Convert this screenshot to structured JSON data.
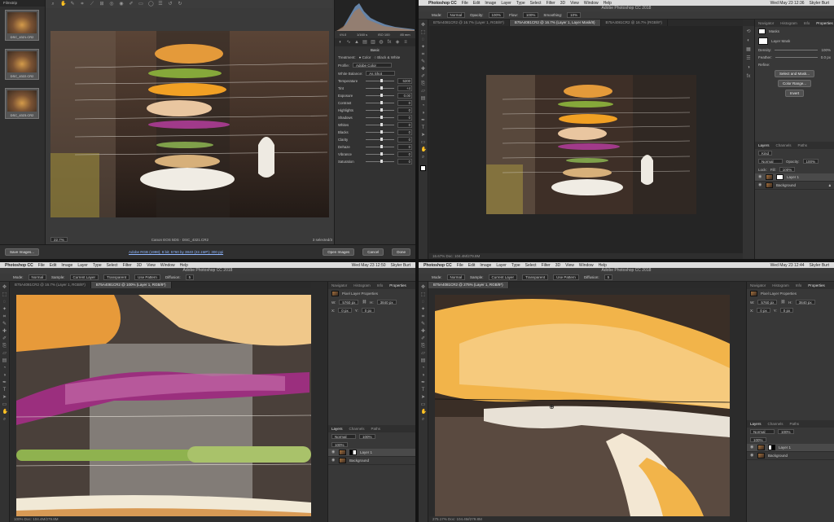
{
  "q1": {
    "filmstrip_title": "Filmstrip",
    "filmstrip": [
      "DSC_4321.CR2",
      "DSC_4322.CR2",
      "DSC_4323.CR2"
    ],
    "zoom": "22.7%",
    "center_caption": "Canon EOS 5DS  ·  DSC_4321.CR2",
    "selected_count": "3 selected/3",
    "bottom_link": "Adobe RGB (1998); 8 bit; 5760 by 3840 (22.1MP); 300 ppi",
    "save_button": "Save Images...",
    "open_button": "Open Images",
    "cancel_button": "Cancel",
    "done_button": "Done",
    "histo_readout": [
      "f/4.0",
      "1/160 s",
      "ISO 100",
      "85 mm"
    ],
    "basic_label": "Basic",
    "treatment_label": "Treatment:",
    "treatment_color": "Color",
    "treatment_bw": "Black & White",
    "profile_label": "Profile:",
    "profile_value": "Adobe Color",
    "wb_label": "White Balance:",
    "wb_value": "As Shot",
    "auto_label": "Auto",
    "default_label": "Default",
    "sliders": [
      {
        "label": "Temperature",
        "value": "5200"
      },
      {
        "label": "Tint",
        "value": "+4"
      },
      {
        "label": "Exposure",
        "value": "0.00"
      },
      {
        "label": "Contrast",
        "value": "0"
      },
      {
        "label": "Highlights",
        "value": "0"
      },
      {
        "label": "Shadows",
        "value": "0"
      },
      {
        "label": "Whites",
        "value": "0"
      },
      {
        "label": "Blacks",
        "value": "0"
      },
      {
        "label": "Clarity",
        "value": "0"
      },
      {
        "label": "Dehaze",
        "value": "0"
      },
      {
        "label": "Vibrance",
        "value": "0"
      },
      {
        "label": "Saturation",
        "value": "0"
      }
    ]
  },
  "menu": {
    "app": "Photoshop CC",
    "items": [
      "File",
      "Edit",
      "Image",
      "Layer",
      "Type",
      "Select",
      "Filter",
      "3D",
      "View",
      "Window",
      "Help"
    ],
    "clock_a": "Wed May 23 12:36",
    "clock_b": "Wed May 23 12:50",
    "clock_c": "Wed May 23 12:44",
    "user": "Skyler Burt"
  },
  "window_title": "Adobe Photoshop CC 2018",
  "q2": {
    "opt": [
      "Mode:",
      "Normal",
      "Opacity:",
      "100%",
      "Flow:",
      "100%",
      "Smoothing:",
      "10%"
    ],
    "tabs": [
      "B75A4081CR2 @ 16.7% (Layer 1, RGB/8*)",
      "B75A4081CR2 @ 16.7% (Layer 1, Layer Mask/8)",
      "B75A4081CR2 @ 16.7% (RGB/8*)"
    ],
    "status": "16.67%    Doc: 104.4M/279.8M",
    "panel_tabs": [
      "Navigator",
      "Histogram",
      "Info",
      "Properties"
    ],
    "props_title": "Masks",
    "mask_label": "Layer Mask",
    "density": "Density:",
    "density_val": "100%",
    "feather": "Feather:",
    "feather_val": "0.0 px",
    "refine": "Refine:",
    "select_mask": "Select and Mask...",
    "color_range": "Color Range...",
    "invert": "Invert",
    "layers_tabs": [
      "Layers",
      "Channels",
      "Paths"
    ],
    "kind": "Kind",
    "blend": "Normal",
    "opacity_label": "Opacity:",
    "opacity": "100%",
    "lock_label": "Lock:",
    "fill_label": "Fill:",
    "fill": "100%",
    "layers": [
      "Layer 1",
      "Background"
    ]
  },
  "q3": {
    "opt": [
      "Mode:",
      "Normal",
      "Sample:",
      "Current Layer",
      "Transparent",
      "Use Pattern",
      "Diffusion:",
      "5"
    ],
    "tabs": [
      "B75A4081CR2 @ 16.7% (Layer 1, RGB/8*)",
      "B75A4081CR2 @ 100% (Layer 1, RGB/8*)"
    ],
    "status": "100%    Doc: 104.4M/279.8M",
    "panel_tabs": [
      "Navigator",
      "Histogram",
      "Info",
      "Properties"
    ],
    "props_title": "Pixel Layer Properties",
    "w_label": "W:",
    "w_val": "5760 px",
    "h_label": "H:",
    "h_val": "3840 px",
    "x_label": "X:",
    "x_val": "0 px",
    "y_label": "Y:",
    "y_val": "0 px",
    "layers_tabs": [
      "Layers",
      "Channels",
      "Paths"
    ],
    "blend": "Normal",
    "opacity": "100%",
    "fill": "100%",
    "layers": [
      "Layer 1",
      "Background"
    ]
  },
  "q4": {
    "opt": [
      "Mode:",
      "Normal",
      "Sample:",
      "Current Layer",
      "Transparent",
      "Use Pattern",
      "Diffusion:",
      "5"
    ],
    "tabs": [
      "B75A4081CR2 @ 275% (Layer 1, RGB/8*)"
    ],
    "status": "275.17%    Doc: 104.4M/279.8M",
    "panel_tabs": [
      "Navigator",
      "Histogram",
      "Info",
      "Properties"
    ],
    "props_title": "Pixel Layer Properties",
    "w_val": "5760 px",
    "h_val": "3840 px",
    "x_val": "0 px",
    "y_val": "0 px",
    "layers_tabs": [
      "Layers",
      "Channels",
      "Paths"
    ],
    "blend": "Normal",
    "opacity": "100%",
    "fill": "100%",
    "layers": [
      "Layer 1",
      "Background"
    ]
  }
}
